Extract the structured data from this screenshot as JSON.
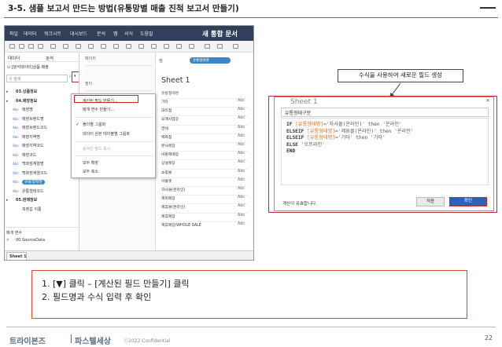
{
  "slide": {
    "title": "3-5. 샘플 보고서 만드는 방법(유통망별 매출 진척 보고서 만들기)",
    "page_number": "22",
    "confidential": "ⓒ2022 Confidential",
    "logo_left": "트라이본즈",
    "logo_right": "파스텔세상"
  },
  "tableau": {
    "menu": [
      "파일",
      "데이터",
      "워크시트",
      "대시보드",
      "분석",
      "맵",
      "서식",
      "도움말"
    ],
    "window_title": "새 통합 문서",
    "data_tab": "데이터",
    "analysis_tab": "분석",
    "datasource": "[분석데이터]상품-매출",
    "search_placeholder": "검색",
    "pages_label": "페이지",
    "filters_label": "필터",
    "marks_label": "마크",
    "rows_label": "행",
    "rows_pill": "유통형태명",
    "sheet_title": "Sheet 1",
    "sheet_tab": "Sheet 1",
    "fields": [
      {
        "type": "",
        "label": "03.상품정보",
        "group": true
      },
      {
        "type": "",
        "label": "04.매장정보",
        "group": true
      },
      {
        "type": "Abc",
        "label": "매장명"
      },
      {
        "type": "Abc",
        "label": "매장브랜드명"
      },
      {
        "type": "Abc",
        "label": "매장브랜드코드"
      },
      {
        "type": "Abc",
        "label": "매장지역명"
      },
      {
        "type": "Abc",
        "label": "매장지역코드"
      },
      {
        "type": "Abc",
        "label": "매장코드"
      },
      {
        "type": "Abc",
        "label": "백화점계열명"
      },
      {
        "type": "Abc",
        "label": "백화점계열코드"
      },
      {
        "type": "Abc",
        "label": "유통형태명",
        "selected": true
      },
      {
        "type": "Abc",
        "label": "유통형태코드"
      },
      {
        "type": "",
        "label": "05.판매정보",
        "group": true
      },
      {
        "type": "",
        "label": "측정값 이름"
      }
    ],
    "params_label": "매개 변수",
    "params_item": "00.SourceData",
    "context_menu": [
      {
        "label": "계산된 필드 만들기...",
        "disabled": false
      },
      {
        "label": "매개 변수 만들기...",
        "disabled": false
      },
      {
        "label": "폴더별 그룹화",
        "disabled": false,
        "checked": true
      },
      {
        "label": "데이터 원본 테이블별 그룹화",
        "disabled": false
      },
      {
        "label": "숨겨진 필드 표시",
        "disabled": true
      },
      {
        "label": "모두 확장",
        "disabled": false
      },
      {
        "label": "모두 축소",
        "disabled": false
      }
    ],
    "view_header": "유통형태명",
    "view_rows": [
      "기타",
      "대리점",
      "도매사업장",
      "면세",
      "백화점",
      "본사매장",
      "비판매매장",
      "상설매장",
      "쇼핑몰",
      "아울렛",
      "자사몰(온라인)",
      "제외매장",
      "제휴몰(온라인)",
      "제휴매장",
      "제휴매장/WHOLE SALE"
    ],
    "view_abc": "Abc"
  },
  "callout_text": "수식을 사용하여 새로운 필드 생성",
  "calc_dialog": {
    "sheet_bg_title": "Sheet 1",
    "field_name": "유통형태구분",
    "close": "×",
    "lines": [
      {
        "kw1": "IF ",
        "field": "[유통형태명]",
        "rest": "='자사몰(온라인)' then '온라인'"
      },
      {
        "kw1": "ELSEIF ",
        "field": "[유통형태명]",
        "rest": "='제휴몰(온라인)' then '온라인'"
      },
      {
        "kw1": "ELSEIF ",
        "field": "[유통형태명]",
        "rest": "='기타' then '기타'"
      },
      {
        "kw1": "ELSE ",
        "field": "",
        "rest": "'오프라인'"
      },
      {
        "kw1": "END",
        "field": "",
        "rest": ""
      }
    ],
    "status": "계산이 유효합니다.",
    "apply_label": "적용",
    "ok_label": "확인"
  },
  "steps": [
    "1.  [▼] 클릭 – [계산된 필드 만들기] 클릭",
    "2.  필드명과 수식 입력 후 확인"
  ],
  "colors": {
    "accent_red": "#d62020",
    "tableau_blue": "#3b86c4",
    "title_bar": "#31405a",
    "ok_button": "#2b63b6"
  }
}
